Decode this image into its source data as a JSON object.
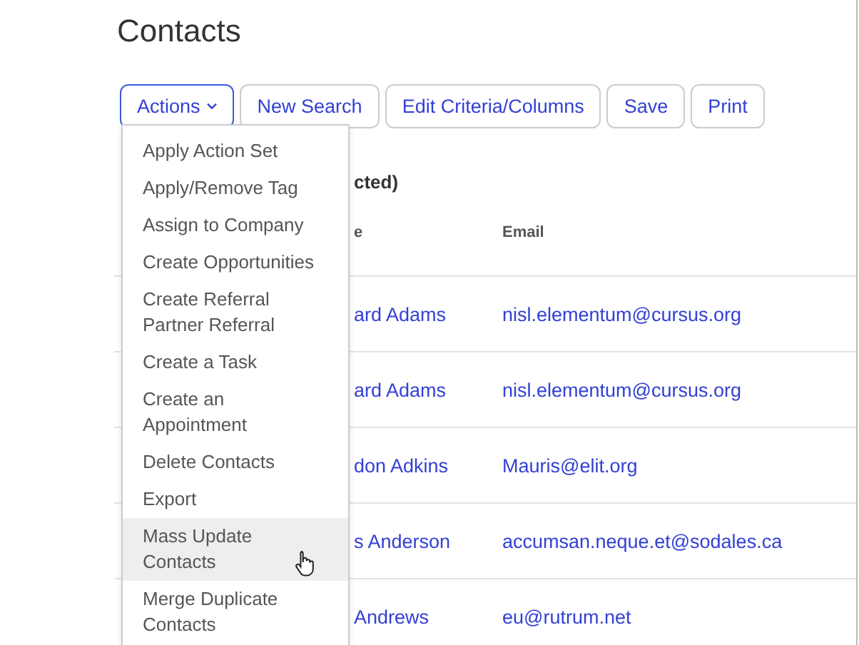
{
  "page": {
    "title": "Contacts"
  },
  "toolbar": [
    {
      "label": "Actions",
      "kind": "dropdown",
      "expanded": true
    },
    {
      "label": "New Search",
      "kind": "plain",
      "expanded": false
    },
    {
      "label": "Edit Criteria/Columns",
      "kind": "plain",
      "expanded": false
    },
    {
      "label": "Save",
      "kind": "plain",
      "expanded": false
    },
    {
      "label": "Print",
      "kind": "plain",
      "expanded": false
    }
  ],
  "actions_menu": [
    {
      "label": "Apply Action Set",
      "selected": false
    },
    {
      "label": "Apply/Remove Tag",
      "selected": false
    },
    {
      "label": "Assign to Company",
      "selected": false
    },
    {
      "label": "Create Opportunities",
      "selected": false
    },
    {
      "label": "Create Referral Partner Referral",
      "selected": false
    },
    {
      "label": "Create a Task",
      "selected": false
    },
    {
      "label": "Create an Appointment",
      "selected": false
    },
    {
      "label": "Delete Contacts",
      "selected": false
    },
    {
      "label": "Export",
      "selected": false
    },
    {
      "label": "Mass Update Contacts",
      "selected": true
    },
    {
      "label": "Merge Duplicate Contacts",
      "selected": false
    }
  ],
  "selection_note": "cted)",
  "table": {
    "columns": [
      "e",
      "Email"
    ],
    "rows": [
      {
        "column_1": "ard Adams",
        "email": "nisl.elementum@cursus.org"
      },
      {
        "column_1": "ard Adams",
        "email": "nisl.elementum@cursus.org"
      },
      {
        "column_1": "don Adkins",
        "email": "Mauris@elit.org"
      },
      {
        "column_1": "s Anderson",
        "email": "accumsan.neque.et@sodales.ca"
      },
      {
        "column_1": "Andrews",
        "email": "eu@rutrum.net"
      }
    ]
  }
}
